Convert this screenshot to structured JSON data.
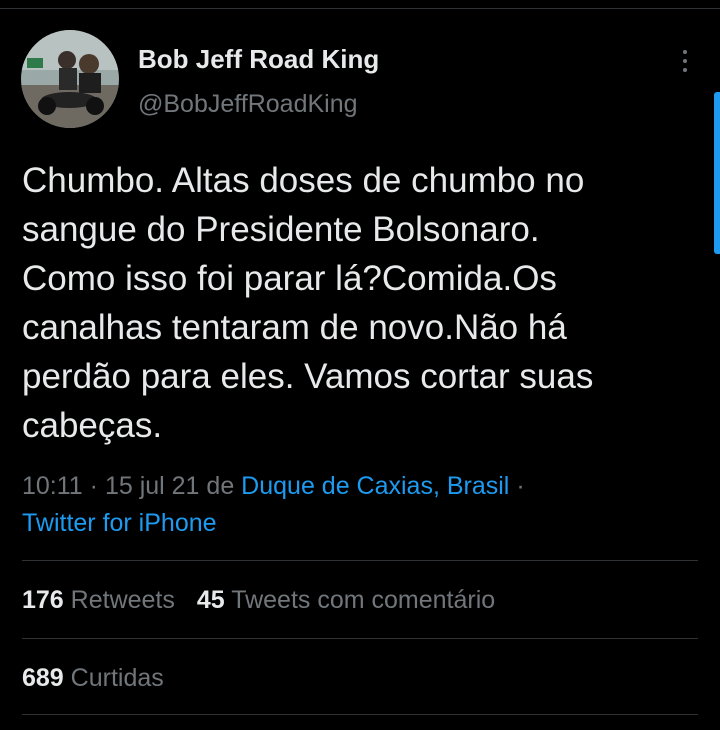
{
  "tweet": {
    "author": {
      "display_name": "Bob Jeff Road King",
      "handle": "@BobJeffRoadKing"
    },
    "text_lines": [
      "Chumbo. Altas doses de chumbo no",
      "sangue do Presidente Bolsonaro.",
      "Como isso foi parar lá?Comida.Os",
      "canalhas tentaram de novo.Não há",
      "perdão para eles. Vamos cortar suas",
      "cabeças."
    ],
    "meta": {
      "time": "10:11",
      "separator": " · ",
      "date": "15 jul 21",
      "location_prefix": " de ",
      "location": "Duque de Caxias, Brasil",
      "trailing_separator": " ·",
      "source": "Twitter for iPhone"
    },
    "stats": {
      "retweets_count": "176",
      "retweets_label": " Retweets",
      "quote_count": "45",
      "quote_label": " Tweets com comentário",
      "likes_count": "689",
      "likes_label": " Curtidas"
    }
  },
  "icons": {
    "more": "more-vertical-icon"
  },
  "colors": {
    "background": "#000000",
    "primary_text": "#e7e9ea",
    "secondary_text": "#71767b",
    "link": "#1d9bf0",
    "divider": "#2f3336"
  }
}
